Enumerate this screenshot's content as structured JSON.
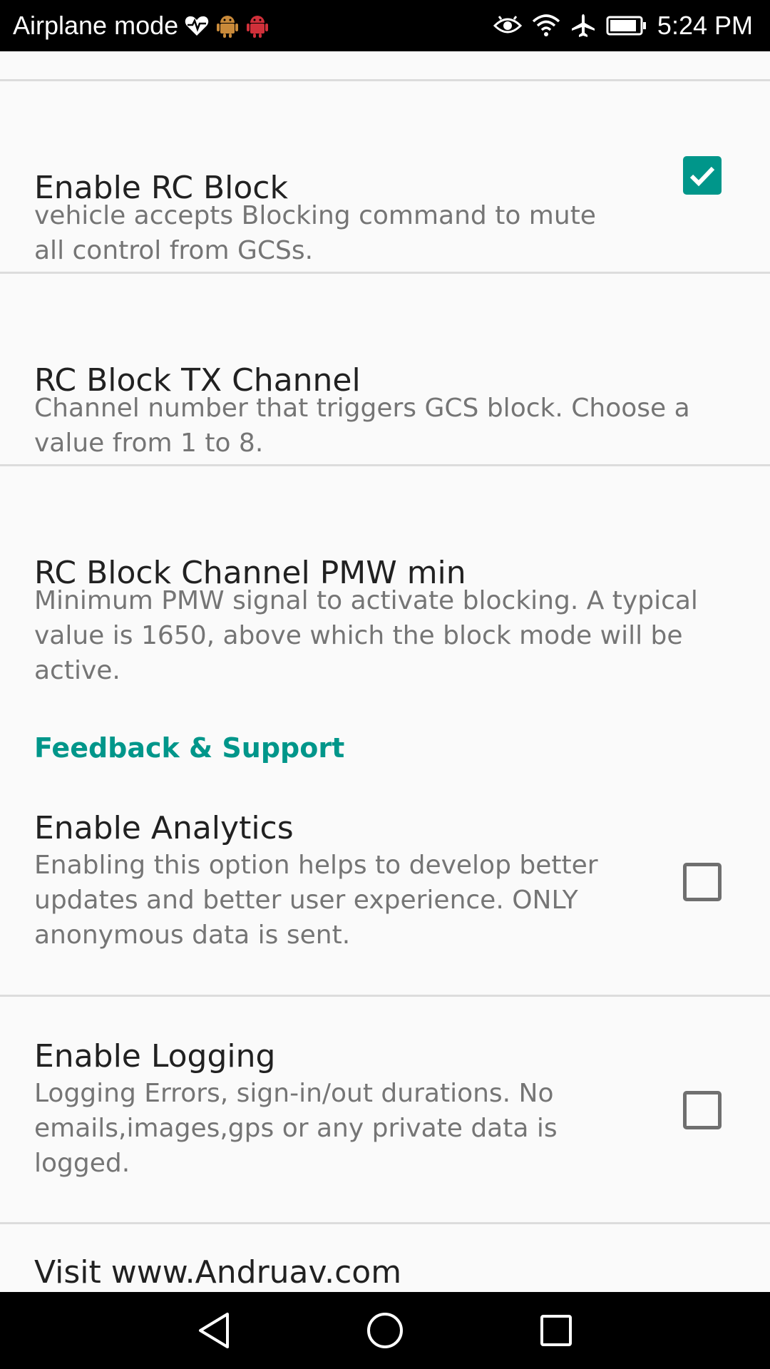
{
  "status_bar": {
    "mode_label": "Airplane mode",
    "time": "5:24 PM",
    "left_icons": [
      "heart-pulse-icon",
      "android-bug-icon",
      "android-bug-red-icon"
    ],
    "right_icons": [
      "eye-icon",
      "wifi-icon",
      "airplane-icon",
      "battery-icon"
    ]
  },
  "preferences": [
    {
      "title": "Enable RC Block",
      "summary": "vehicle accepts Blocking command to mute all control from GCSs.",
      "checkbox": true
    },
    {
      "title": "RC Block TX Channel",
      "summary": "Channel number that triggers GCS block. Choose a value from 1 to 8."
    },
    {
      "title": "RC Block Channel PMW min",
      "summary": "Minimum PMW signal to activate blocking. A typical value is 1650, above which the block mode will be active."
    }
  ],
  "section": {
    "header": "Feedback & Support",
    "items": [
      {
        "title": "Enable Analytics",
        "summary": "Enabling this option helps to develop better updates and better user experience. ONLY anonymous data is sent.",
        "checkbox": false
      },
      {
        "title": "Enable Logging",
        "summary": "Logging Errors, sign-in/out durations. No emails,images,gps or any private data is logged.",
        "checkbox": false
      },
      {
        "title": "Visit www.Andruav.com"
      }
    ]
  },
  "nav_bar": {
    "buttons": [
      "back-icon",
      "home-icon",
      "recents-icon"
    ]
  },
  "colors": {
    "accent": "#00968a",
    "title_text": "#212121",
    "summary_text": "#757575",
    "background": "#fafafa"
  }
}
